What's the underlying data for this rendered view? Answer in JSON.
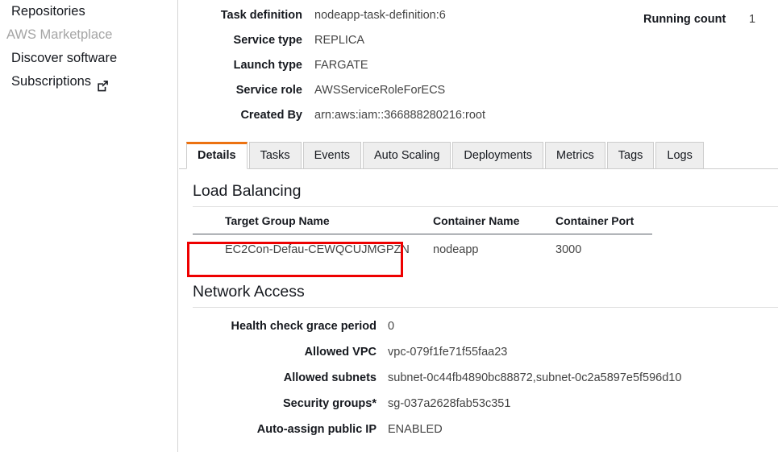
{
  "sidebar": {
    "items": [
      {
        "label": "Repositories",
        "type": "nav",
        "external": false
      },
      {
        "label": "AWS Marketplace",
        "type": "section",
        "external": false
      },
      {
        "label": "Discover software",
        "type": "nav",
        "external": false
      },
      {
        "label": "Subscriptions",
        "type": "nav",
        "external": true,
        "icon": "external-link-icon"
      }
    ]
  },
  "service_details": {
    "rows": [
      {
        "label": "Task definition",
        "value": "nodeapp-task-definition:6",
        "is_link": true
      },
      {
        "label": "Service type",
        "value": "REPLICA",
        "is_link": false
      },
      {
        "label": "Launch type",
        "value": "FARGATE",
        "is_link": false
      },
      {
        "label": "Service role",
        "value": "AWSServiceRoleForECS",
        "is_link": false
      },
      {
        "label": "Created By",
        "value": "arn:aws:iam::366888280216:root",
        "is_link": false
      }
    ],
    "running_count_label": "Running count",
    "running_count_value": "1"
  },
  "tabs": {
    "items": [
      {
        "label": "Details",
        "active": true
      },
      {
        "label": "Tasks",
        "active": false
      },
      {
        "label": "Events",
        "active": false
      },
      {
        "label": "Auto Scaling",
        "active": false
      },
      {
        "label": "Deployments",
        "active": false
      },
      {
        "label": "Metrics",
        "active": false
      },
      {
        "label": "Tags",
        "active": false
      },
      {
        "label": "Logs",
        "active": false
      }
    ]
  },
  "load_balancing": {
    "title": "Load Balancing",
    "columns": [
      "Target Group Name",
      "Container Name",
      "Container Port"
    ],
    "rows": [
      {
        "target_group_name": "EC2Con-Defau-CEWQCUJMGPZN",
        "container_name": "nodeapp",
        "container_port": "3000"
      }
    ]
  },
  "network_access": {
    "title": "Network Access",
    "rows": [
      {
        "label": "Health check grace period",
        "value": "0",
        "is_link": false
      },
      {
        "label": "Allowed VPC",
        "value": "vpc-079f1fe71f55faa23",
        "is_link": true
      },
      {
        "label": "Allowed subnets",
        "value": "subnet-0c44fb4890bc88872,subnet-0c2a5897e5f596d10",
        "is_link": true
      },
      {
        "label": "Security groups*",
        "value": "sg-037a2628fab53c351",
        "is_link": true
      },
      {
        "label": "Auto-assign public IP",
        "value": "ENABLED",
        "is_link": false
      }
    ]
  },
  "annotation": {
    "type": "highlight-box",
    "color": "#ee0000",
    "target": "EC2Con-Defau-CEWQCUJMGPZN"
  },
  "colors": {
    "link": "#0073bb",
    "active_tab_accent": "#ec7211",
    "annotation": "#ee0000",
    "text": "#16191f",
    "muted_text": "#a5a5a5"
  }
}
